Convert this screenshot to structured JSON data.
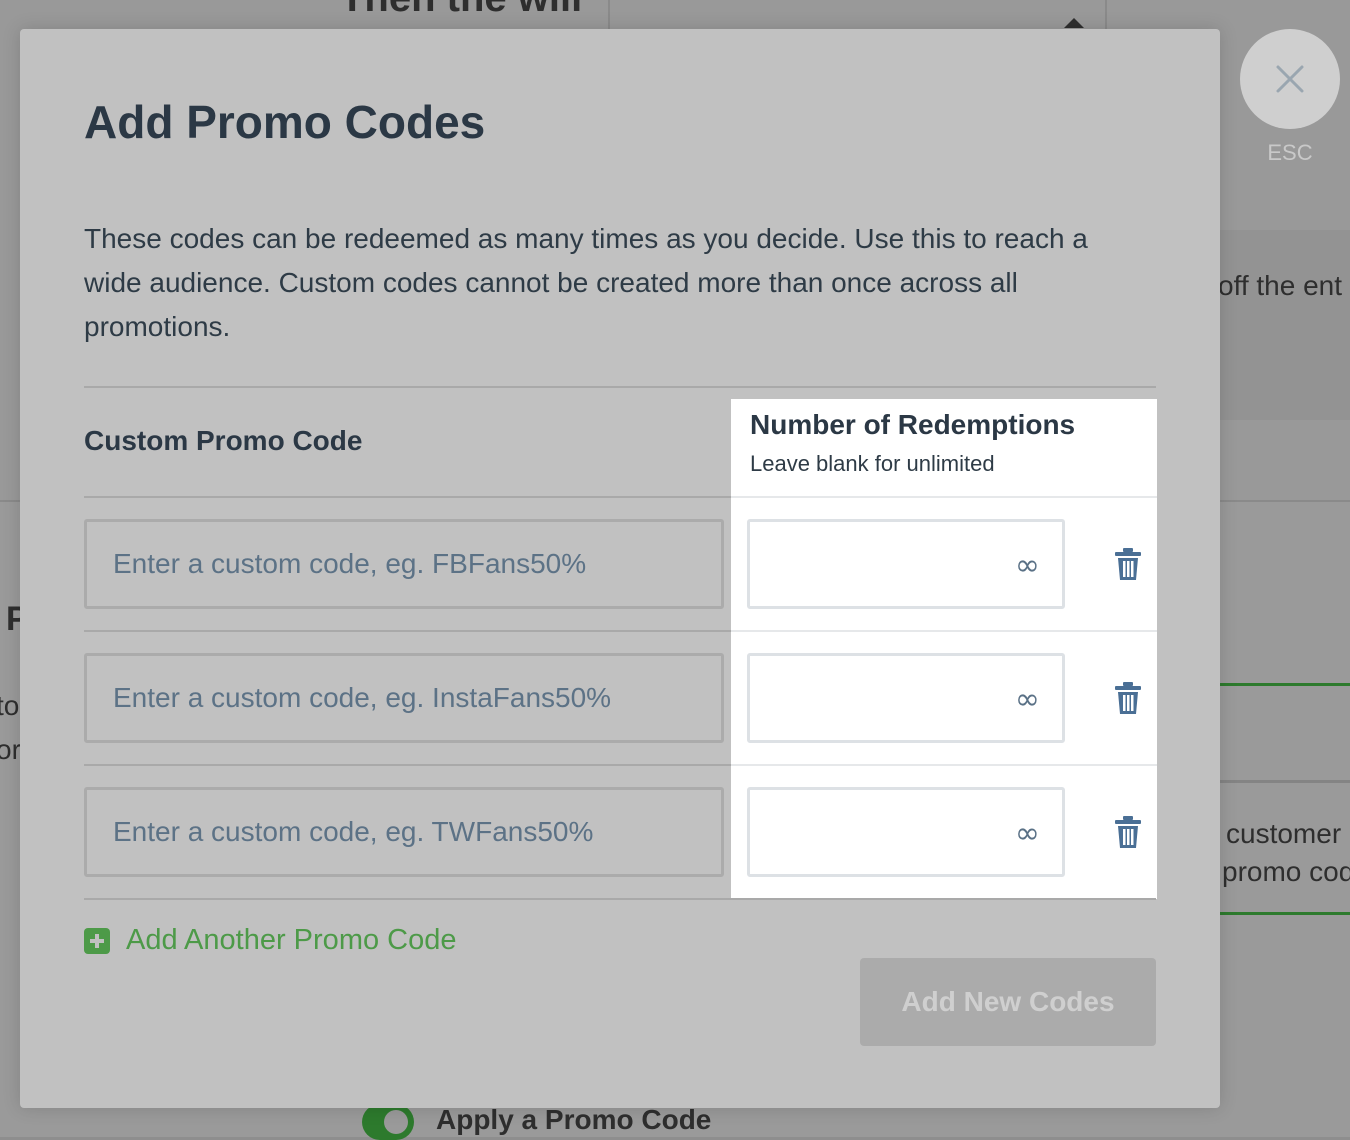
{
  "background": {
    "cut_heading": "Then the will",
    "right_fragment_1": "off the ent",
    "left_letter": "P",
    "left_fragment_1": "to",
    "left_fragment_2": "or",
    "right_fragment_2": "customer",
    "right_fragment_3": "promo cod",
    "apply_label": "Apply a Promo Code"
  },
  "close": {
    "label": "ESC",
    "icon": "close-icon"
  },
  "modal": {
    "title": "Add Promo Codes",
    "description": "These codes can be redeemed as many times as you decide. Use this to reach a wide audience. Custom codes cannot be created more than once across all promotions.",
    "columns": {
      "code": "Custom Promo Code",
      "redemptions_title": "Number of Redemptions",
      "redemptions_subtitle": "Leave blank for unlimited"
    },
    "rows": [
      {
        "code_placeholder": "Enter a custom code, eg. FBFans50%",
        "code_value": "",
        "redemptions_value": "",
        "redemptions_hint": "∞"
      },
      {
        "code_placeholder": "Enter a custom code, eg. InstaFans50%",
        "code_value": "",
        "redemptions_value": "",
        "redemptions_hint": "∞"
      },
      {
        "code_placeholder": "Enter a custom code, eg. TWFans50%",
        "code_value": "",
        "redemptions_value": "",
        "redemptions_hint": "∞"
      }
    ],
    "add_another_label": "Add Another Promo Code",
    "submit_label": "Add New Codes"
  },
  "colors": {
    "accent_green": "#4d9a48",
    "title_text": "#2b3845",
    "placeholder_text": "#5c7286",
    "disabled_button": "#ababab"
  }
}
